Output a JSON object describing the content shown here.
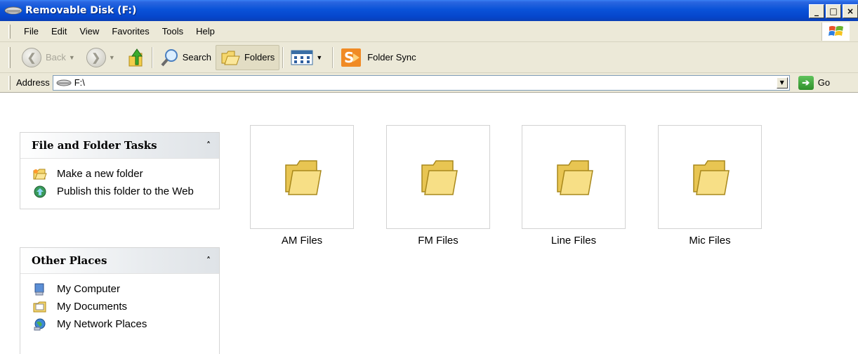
{
  "window": {
    "title": "Removable Disk (F:)",
    "minimize": "_",
    "maximize": "□",
    "close": "×"
  },
  "menu": [
    "File",
    "Edit",
    "View",
    "Favorites",
    "Tools",
    "Help"
  ],
  "toolbar": {
    "back": "Back",
    "search": "Search",
    "folders": "Folders",
    "folder_sync": "Folder Sync"
  },
  "address": {
    "label": "Address",
    "value": "F:\\",
    "go": "Go"
  },
  "panes": {
    "file_tasks": {
      "title": "File and Folder Tasks",
      "items": [
        {
          "label": "Make a new folder",
          "icon": "new-folder-icon"
        },
        {
          "label": "Publish this folder to the Web",
          "icon": "publish-web-icon"
        }
      ]
    },
    "other_places": {
      "title": "Other Places",
      "items": [
        {
          "label": "My Computer",
          "icon": "my-computer-icon"
        },
        {
          "label": "My Documents",
          "icon": "my-documents-icon"
        },
        {
          "label": "My Network Places",
          "icon": "network-places-icon"
        }
      ]
    }
  },
  "folders": [
    "AM Files",
    "FM Files",
    "Line Files",
    "Mic Files"
  ],
  "colors": {
    "titlebar": "#0a52d8",
    "chrome": "#ece9d8",
    "folder": "#f5d76e"
  }
}
